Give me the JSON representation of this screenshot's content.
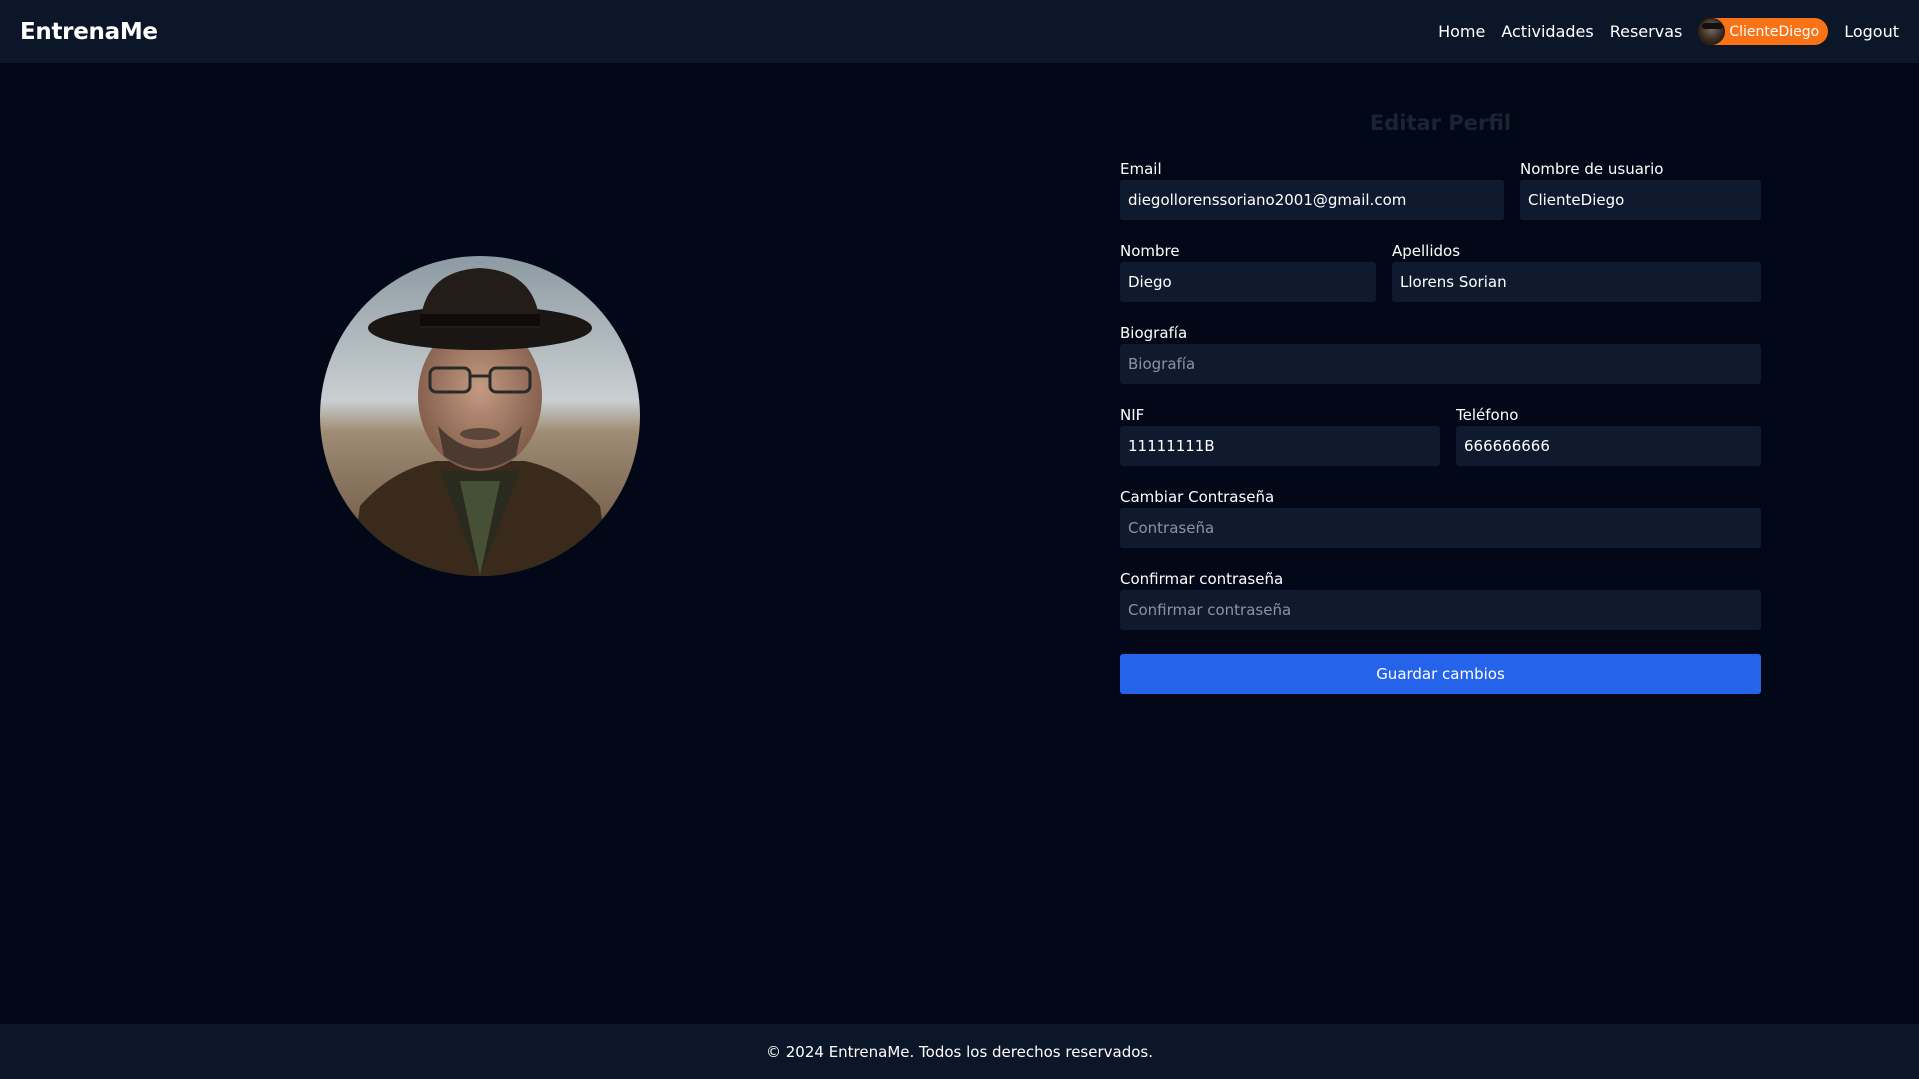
{
  "navbar": {
    "brand": "EntrenaMe",
    "links": [
      "Home",
      "Actividades",
      "Reservas"
    ],
    "user_label": "ClienteDiego",
    "logout_label": "Logout"
  },
  "profile": {
    "title": "Editar Perfil",
    "email": {
      "label": "Email",
      "value": "diegollorenssoriano2001@gmail.com"
    },
    "username": {
      "label": "Nombre de usuario",
      "value": "ClienteDiego"
    },
    "first_name": {
      "label": "Nombre",
      "value": "Diego"
    },
    "last_name": {
      "label": "Apellidos",
      "value": "Llorens Sorian"
    },
    "bio": {
      "label": "Biografía",
      "placeholder": "Biografía",
      "value": ""
    },
    "nif": {
      "label": "NIF",
      "value": "11111111B"
    },
    "phone": {
      "label": "Teléfono",
      "value": "666666666"
    },
    "password": {
      "label": "Cambiar Contraseña",
      "placeholder": "Contraseña",
      "value": ""
    },
    "confirm_password": {
      "label": "Confirmar contraseña",
      "placeholder": "Confirmar contraseña",
      "value": ""
    },
    "save_label": "Guardar cambios"
  },
  "footer": {
    "text": "© 2024 EntrenaMe. Todos los derechos reservados."
  },
  "colors": {
    "background": "#020817",
    "navbar": "#0b1628",
    "input": "#0f1a2e",
    "accent_orange": "#f97316",
    "button_blue": "#2563eb"
  }
}
